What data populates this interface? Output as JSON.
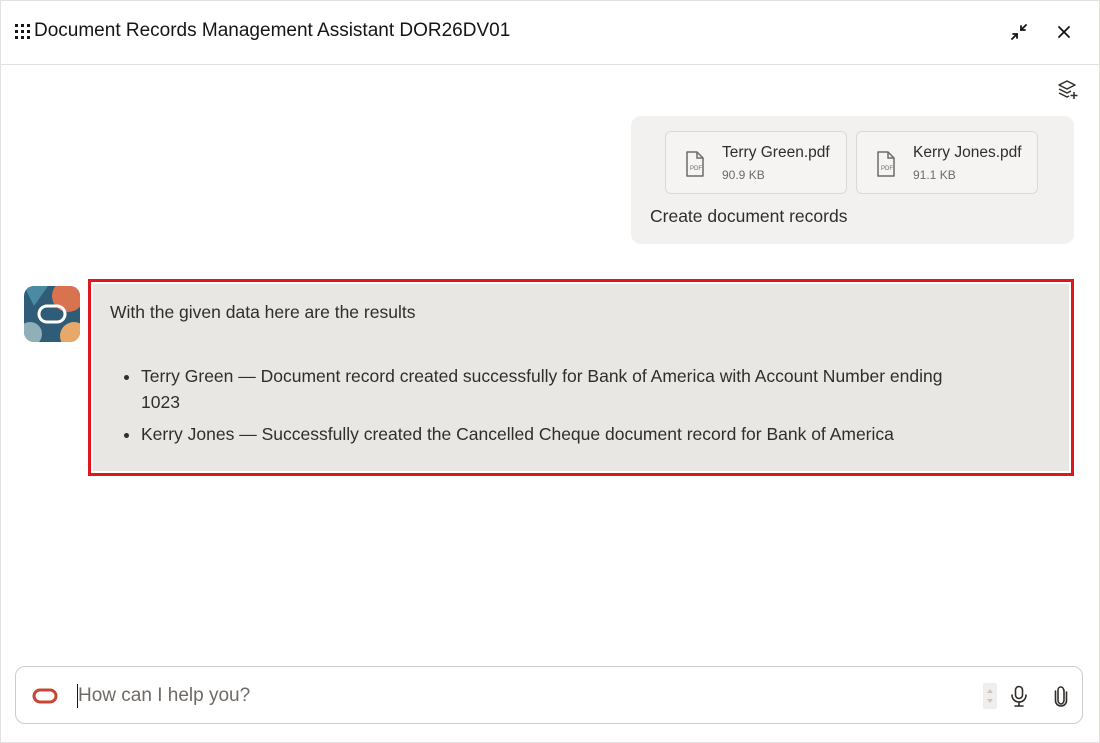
{
  "header": {
    "title": "Document Records Management Assistant DOR26DV01",
    "apps_icon": "grid-icon",
    "minimize_icon": "collapse-icon",
    "close_icon": "close-icon"
  },
  "toolbar": {
    "layers_icon": "layers-add-icon"
  },
  "conversation": {
    "user_message": {
      "attachments": [
        {
          "name": "Terry Green.pdf",
          "size": "90.9 KB",
          "icon": "pdf-file-icon"
        },
        {
          "name": "Kerry Jones.pdf",
          "size": "91.1 KB",
          "icon": "pdf-file-icon"
        }
      ],
      "text": "Create document records"
    },
    "bot_message": {
      "intro": "With the given data here are the results",
      "items": [
        "Terry Green — Document record created successfully for Bank of America with Account Number ending 1023",
        "Kerry Jones — Successfully created the Cancelled Cheque document record for Bank of America"
      ],
      "highlight_color": "#e0161c"
    }
  },
  "composer": {
    "placeholder": "How can I help you?",
    "value": "",
    "mic_icon": "microphone-icon",
    "attach_icon": "paperclip-icon"
  },
  "colors": {
    "brand": "#c74634",
    "message_bg": "#f3f1ef",
    "bot_bg": "#e9e7e4"
  }
}
